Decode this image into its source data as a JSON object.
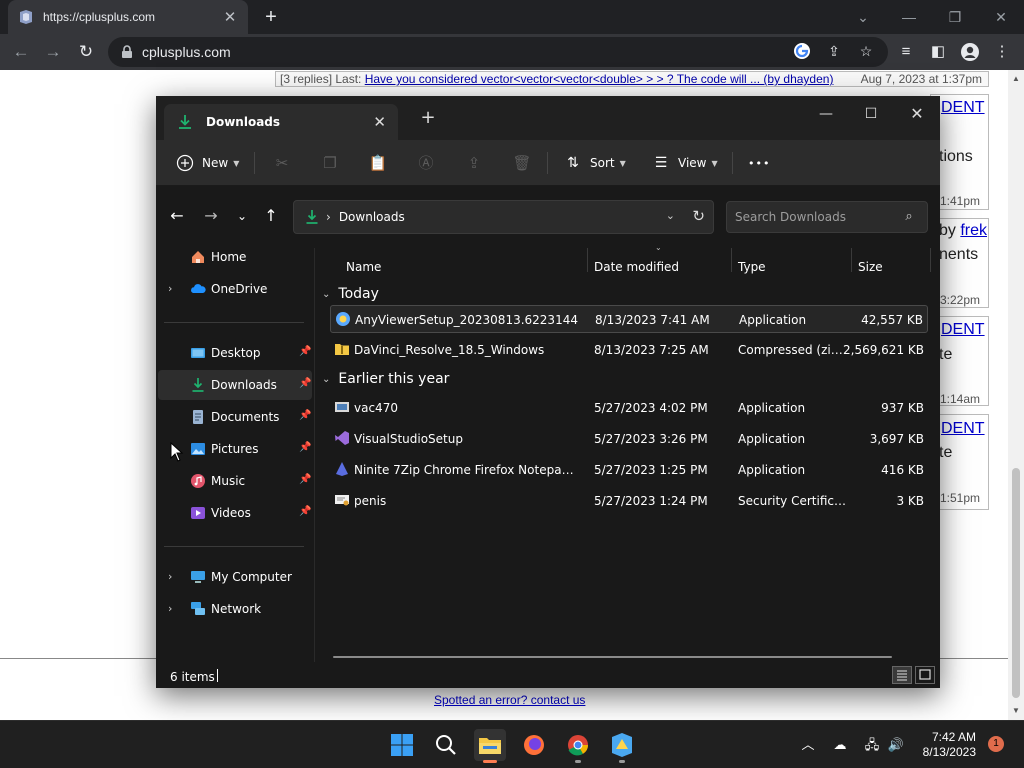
{
  "browser": {
    "tab_title": "https://cplusplus.com",
    "tab_close": "✕",
    "new_tab": "+",
    "url": "cplusplus.com"
  },
  "webpage": {
    "reply_prefix": "[3 replies] Last: ",
    "reply_link": "Have you considered vector<vector<vector<double> > > ? The code will ... (by dhayden)",
    "reply_date": "Aug 7, 2023 at 1:37pm",
    "bg_fragments": {
      "dent_1": "DENT",
      "tions": "tions",
      "time_1": "1:41pm",
      "by": "by ",
      "frek": "frek",
      "nents": "nents",
      "time_2": "3:22pm",
      "dent_2": "DENT",
      "te_1": "te",
      "time_3": "1:14am",
      "dent_3": "DENT",
      "te_2": "te",
      "time_4": "1:51pm"
    },
    "footer_link": "Spotted an error? contact us"
  },
  "explorer": {
    "tab_title": "Downloads",
    "tab_close": "✕",
    "new_tab": "+",
    "commands": {
      "new": "New",
      "sort": "Sort",
      "view": "View",
      "more": "•••"
    },
    "address": {
      "separator": "›",
      "location": "Downloads"
    },
    "search_placeholder": "Search Downloads",
    "sidebar": {
      "home": "Home",
      "onedrive": "OneDrive",
      "desktop": "Desktop",
      "downloads": "Downloads",
      "documents": "Documents",
      "pictures": "Pictures",
      "music": "Music",
      "videos": "Videos",
      "my_computer": "My Computer",
      "network": "Network"
    },
    "columns": {
      "name": "Name",
      "date": "Date modified",
      "type": "Type",
      "size": "Size"
    },
    "groups": [
      {
        "title": "Today",
        "files": [
          {
            "name": "AnyViewerSetup_20230813.6223144",
            "date": "8/13/2023 7:41 AM",
            "type": "Application",
            "size": "42,557 KB"
          },
          {
            "name": "DaVinci_Resolve_18.5_Windows",
            "date": "8/13/2023 7:25 AM",
            "type": "Compressed (zipp...",
            "size": "2,569,621 KB"
          }
        ]
      },
      {
        "title": "Earlier this year",
        "files": [
          {
            "name": "vac470",
            "date": "5/27/2023 4:02 PM",
            "type": "Application",
            "size": "937 KB"
          },
          {
            "name": "VisualStudioSetup",
            "date": "5/27/2023 3:26 PM",
            "type": "Application",
            "size": "3,697 KB"
          },
          {
            "name": "Ninite 7Zip Chrome Firefox Notepad Inst...",
            "date": "5/27/2023 1:25 PM",
            "type": "Application",
            "size": "416 KB"
          },
          {
            "name": "penis",
            "date": "5/27/2023 1:24 PM",
            "type": "Security Certificate",
            "size": "3 KB"
          }
        ]
      }
    ],
    "status": "6 items"
  },
  "taskbar": {
    "time": "7:42 AM",
    "date": "8/13/2023",
    "notifications": "1"
  },
  "colors": {
    "explorer_bg": "#191919",
    "download_green": "#1fb36f",
    "folder_yellow": "#f3c744",
    "onedrive_blue": "#1e90ff",
    "chrome_toolbar": "#35363a"
  }
}
